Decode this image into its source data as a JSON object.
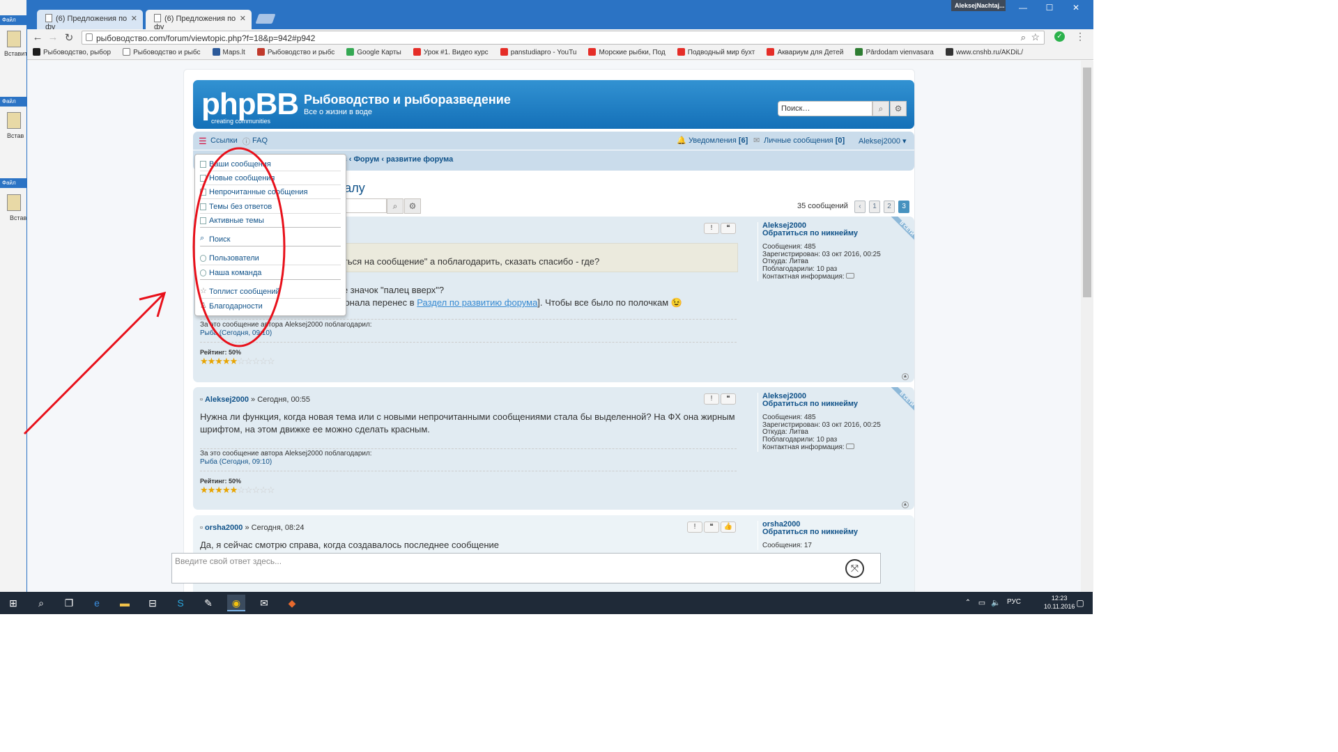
{
  "bg_app": {
    "file_label": "Файл",
    "paste_label": "Вставить",
    "paste_label_short": "Встав"
  },
  "window": {
    "tabs": [
      {
        "title": "(6) Предложения по фу"
      },
      {
        "title": "(6) Предложения по фу"
      }
    ],
    "user_label": "AleksejNachtaj...",
    "minimize": "—",
    "maximize": "☐",
    "close": "✕"
  },
  "toolbar": {
    "url": "рыбоводство.com/forum/viewtopic.php?f=18&p=942#p942"
  },
  "bookmarks": [
    {
      "label": "Рыбоводство, рыбор",
      "color": "#1d1d1d"
    },
    {
      "label": "Рыбоводство и рыбс",
      "color": "#ffffff"
    },
    {
      "label": "Maps.lt",
      "color": "#2c5a9a"
    },
    {
      "label": "Рыбоводство и рыбс",
      "color": "#c0392b"
    },
    {
      "label": "Google Карты",
      "color": "#34a853"
    },
    {
      "label": "Урок #1. Видео курс",
      "color": "#e52d27"
    },
    {
      "label": "panstudiapro - YouTu",
      "color": "#e52d27"
    },
    {
      "label": "Морские рыбки, Под",
      "color": "#e52d27"
    },
    {
      "label": "Подводный мир бухт",
      "color": "#e52d27"
    },
    {
      "label": "Аквариум для Детей",
      "color": "#e52d27"
    },
    {
      "label": "Pārdodam vienvasara",
      "color": "#2e7d32"
    },
    {
      "label": "www.cnshb.ru/AKDiL/",
      "color": "#333333"
    }
  ],
  "forum": {
    "site_title": "Рыбоводство и рыборазведение",
    "site_desc": "Все о жизни в воде",
    "logo_text": "phpBB",
    "logo_sub": "creating    communities",
    "search_placeholder": "Поиск…",
    "nav": {
      "links": "Ссылки",
      "faq": "FAQ",
      "notifications": "Уведомления",
      "notif_count": "[6]",
      "pm": "Личные сообщения",
      "pm_count": "[0]",
      "username": "Aleksej2000 ▾"
    },
    "breadcrumbs": "орумов  ‹  Форум  ‹  развитие форума",
    "topic_title": "кционалу",
    "topic_search_placeholder": "в теме...",
    "post_count": "35 сообщений",
    "pages": [
      "1",
      "2",
      "3"
    ],
    "current_page": "3"
  },
  "dropdown": [
    "Ваши сообщения",
    "Новые сообщения",
    "Непрочитанные сообщения",
    "Темы без ответов",
    "Активные темы",
    "Поиск",
    "Пользователи",
    "Наша команда",
    "Топлист сообщений",
    "Благодарности"
  ],
  "posts": [
    {
      "quote_text": "аловаться на сообщение\" а поблагодарить, сказать спасибо - где?",
      "line1": "видите значок \"палец вверх\"?",
      "line2_pre": "фукционала перенес в ",
      "line2_link": "Раздел по развитию форума",
      "line2_post": "]. Чтобы все было по полочкам 😉",
      "thanks_label": "За это сообщение автора Aleksej2000 поблагодарил:",
      "thanks_user": "Рыба (Сегодня, 09:10)",
      "rating": "Рейтинг: 50%",
      "rating_fraction": 0.5,
      "profile": {
        "name": "Aleksej2000",
        "contact": "Обратиться по никнейму",
        "posts": "Сообщения: 485",
        "registered": "Зарегистрирован: 03 окт 2016, 00:25",
        "from": "Откуда: Литва",
        "thanked": "Поблагодарили: 10 раз",
        "contact_info": "Контактная информация:"
      },
      "online": "В СЕТИ"
    },
    {
      "author": "Aleksej2000",
      "date": "» Сегодня, 00:55",
      "text": "Нужна ли функция, когда новая тема или с новыми непрочитанными сообщениями стала бы выделенной? На ФХ она жирным шрифтом, на этом движке ее можно сделать красным.",
      "thanks_label": "За это сообщение автора Aleksej2000 поблагодарил:",
      "thanks_user": "Рыба (Сегодня, 09:10)",
      "rating": "Рейтинг: 50%",
      "rating_fraction": 0.5,
      "profile": {
        "name": "Aleksej2000",
        "contact": "Обратиться по никнейму",
        "posts": "Сообщения: 485",
        "registered": "Зарегистрирован: 03 окт 2016, 00:25",
        "from": "Откуда: Литва",
        "thanked": "Поблагодарили: 10 раз",
        "contact_info": "Контактная информация:"
      },
      "online": "В СЕТИ"
    },
    {
      "author": "orsha2000",
      "date": "» Сегодня, 08:24",
      "text": "Да, я сейчас смотрю справа, когда создавалось последнее сообщение",
      "profile": {
        "name": "orsha2000",
        "contact": "Обратиться по никнейму",
        "posts": "Сообщения: 17"
      }
    }
  ],
  "reply_placeholder": "Введите свой ответ здесь...",
  "taskbar": {
    "lang": "РУС",
    "time": "12:23",
    "date": "10.11.2016"
  },
  "annotation": {
    "color": "#e8101a"
  }
}
